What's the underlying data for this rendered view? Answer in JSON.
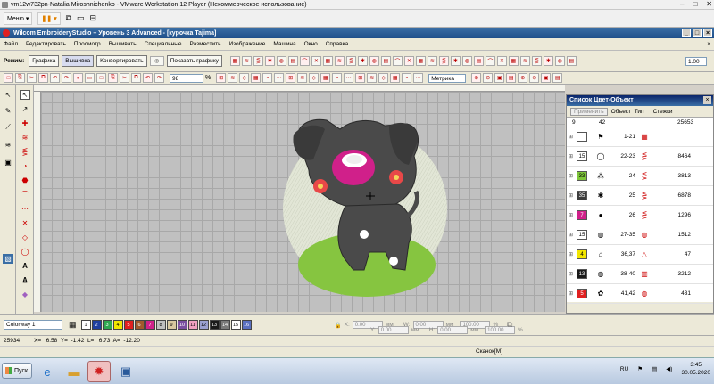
{
  "vm_window": {
    "title": "vm12w732pn-Natalia Miroshnichenko - VMware Workstation 12 Player (Некоммерческое использование)",
    "menu_label": "Меню",
    "controls": [
      "–",
      "□",
      "✕"
    ]
  },
  "app": {
    "title": "Wilcom EmbroideryStudio – Уровень 3 Advanced - [курочка     Tajima]",
    "menu": [
      "Файл",
      "Редактировать",
      "Просмотр",
      "Вышивать",
      "Специальные",
      "Разместить",
      "Изображение",
      "Машина",
      "Окно",
      "Справка"
    ]
  },
  "toolbar1": {
    "mode_label": "Режим:",
    "modes": [
      "Графика",
      "Вышивка",
      "Конвертировать"
    ],
    "active_mode": "Вышивка",
    "show_graphics": "Показать графику",
    "width_value": "1.00"
  },
  "toolbar2": {
    "zoom": "98",
    "zoom_unit": "%",
    "units": "Метрика"
  },
  "color_panel": {
    "title": "Список Цвет-Объект",
    "apply_button": "Применить",
    "columns": [
      "Объект",
      "Тип",
      "Стежки"
    ],
    "totals": {
      "colors": "9",
      "objects": "42",
      "stitches": "25653"
    },
    "rows": [
      {
        "chip": "",
        "chip_color": "#ffffff",
        "range": "1-21",
        "stitches": "",
        "obj_icon": "⚑",
        "type_icon": "▦"
      },
      {
        "chip": "15",
        "chip_color": "#ffffff",
        "range": "22-23",
        "stitches": "8464",
        "obj_icon": "◯",
        "type_icon": "⋚"
      },
      {
        "chip": "33",
        "chip_color": "#7ec63a",
        "range": "24",
        "stitches": "3813",
        "obj_icon": "⁂",
        "type_icon": "⋚"
      },
      {
        "chip": "35",
        "chip_color": "#3c3c3c",
        "range": "25",
        "stitches": "6878",
        "obj_icon": "✱",
        "type_icon": "⋚"
      },
      {
        "chip": "7",
        "chip_color": "#d0208a",
        "range": "26",
        "stitches": "1296",
        "obj_icon": "●",
        "type_icon": "⋚"
      },
      {
        "chip": "15",
        "chip_color": "#ffffff",
        "range": "27-35",
        "stitches": "1512",
        "obj_icon": "◍",
        "type_icon": "◍"
      },
      {
        "chip": "4",
        "chip_color": "#f2e600",
        "range": "36,37",
        "stitches": "47",
        "obj_icon": "⌂",
        "type_icon": "△"
      },
      {
        "chip": "13",
        "chip_color": "#1a1a1a",
        "range": "38-40",
        "stitches": "3212",
        "obj_icon": "◍",
        "type_icon": "▥"
      },
      {
        "chip": "5",
        "chip_color": "#e02020",
        "range": "41,42",
        "stitches": "431",
        "obj_icon": "✿",
        "type_icon": "◍"
      }
    ]
  },
  "bottom": {
    "colorway": "Colorway 1",
    "palette": [
      {
        "n": "1",
        "c": "#ffffff"
      },
      {
        "n": "2",
        "c": "#1f3fa0"
      },
      {
        "n": "3",
        "c": "#2fa84f"
      },
      {
        "n": "4",
        "c": "#f2e600"
      },
      {
        "n": "5",
        "c": "#e02020"
      },
      {
        "n": "6",
        "c": "#a05a2c"
      },
      {
        "n": "7",
        "c": "#d0208a"
      },
      {
        "n": "8",
        "c": "#bfbfbf"
      },
      {
        "n": "9",
        "c": "#d8c8a0"
      },
      {
        "n": "10",
        "c": "#7a50a0"
      },
      {
        "n": "11",
        "c": "#f0a0c0"
      },
      {
        "n": "12",
        "c": "#9aa0d0"
      },
      {
        "n": "13",
        "c": "#1a1a1a"
      },
      {
        "n": "14",
        "c": "#7a7a7a"
      },
      {
        "n": "15",
        "c": "#ffffff"
      },
      {
        "n": "16",
        "c": "#5a70c0"
      }
    ],
    "x_label": "X:",
    "x_val": "0.00",
    "y_label": "Y:",
    "y_val": "0.00",
    "w_label": "W:",
    "w_val": "0.00",
    "h_label": "H:",
    "h_val": "0.00",
    "unit": "мм",
    "pct": "100.00",
    "pct_unit": "%"
  },
  "status": {
    "stitches": "25934",
    "coords": "X=   6.58  Y=  -1.42  L=   6.73  A=  -12.20",
    "hint": "Скачок[M]"
  },
  "taskbar": {
    "start": "Пуск",
    "lang": "RU",
    "time": "3:45",
    "date": "30.05.2020"
  }
}
